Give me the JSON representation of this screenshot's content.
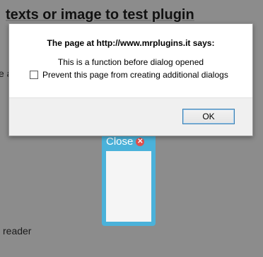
{
  "background": {
    "heading": "texts or image to test plugin",
    "fragment": "e a",
    "footer_text": "reader"
  },
  "popup": {
    "close_label": "Close",
    "close_icon": "close-icon"
  },
  "dialog": {
    "title": "The page at http://www.mrplugins.it says:",
    "message": "This is a function before dialog opened",
    "checkbox_label": "Prevent this page from creating additional dialogs",
    "checkbox_checked": false,
    "ok_label": "OK"
  },
  "colors": {
    "overlay": "#737373",
    "popup_border": "#4bb2da",
    "close_icon": "#e0504d",
    "ok_border": "#3c7fb1"
  }
}
